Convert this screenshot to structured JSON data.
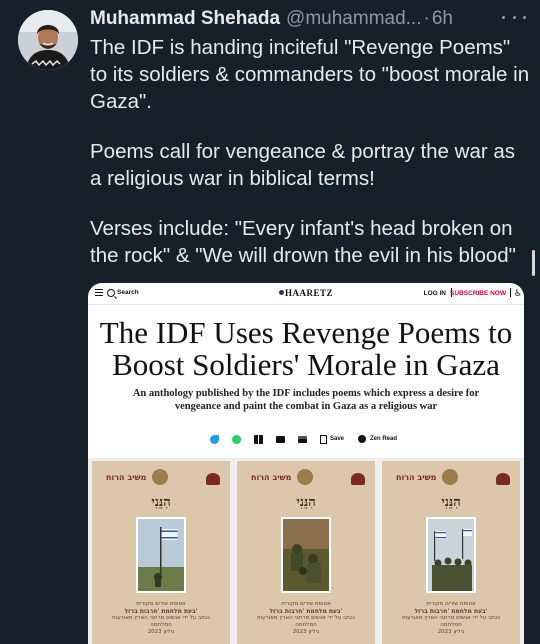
{
  "tweet": {
    "display_name": "Muhammad Shehada",
    "handle": "@muhammad...",
    "separator": "·",
    "time": "6h",
    "paragraphs": [
      "The IDF is handing inciteful \"Revenge Poems\" to its soldiers & commanders to \"boost morale in Gaza\".",
      "Poems call for vengeance & portray the war as a religious war in biblical terms!",
      "Verses include: \"Every infant's head broken on the rock\" & \"We will drown the evil in his blood\""
    ],
    "avatar_icon": "user-avatar",
    "more_icon": "more-horizontal-icon"
  },
  "article_card": {
    "nav": {
      "search_label": "Search",
      "logo": "HAARETZ",
      "login": "LOG IN",
      "subscribe": "SUBSCRIBE NOW",
      "subscribe_color": "#e4003a",
      "accessibility_icon": "♿"
    },
    "headline": "The IDF Uses Revenge Poems to Boost Soldiers' Morale in Gaza",
    "subheadline": "An anthology published by the IDF includes poems which express a desire for vengeance and paint the combat in Gaza as a religious war",
    "share": {
      "icons": [
        "twitter-icon",
        "whatsapp-icon",
        "gift-icon",
        "mail-icon",
        "print-icon"
      ],
      "save_label": "Save",
      "zen_label": "Zen Read"
    },
    "covers": [
      {
        "top_left": "משיב הרוח",
        "title": "הִנֵּנִי",
        "caption_1": "אסופת שירים מקורית",
        "caption_2": "בעת מלחמת 'חרבות ברזל'",
        "caption_3": "נכתב על ידי אנשים מרחבי הארץ מאורעות המלחמה",
        "caption_4": "2023 גיליון"
      },
      {
        "top_left": "משיב הרוח",
        "title": "הִנֵּנִי",
        "caption_1": "אסופת שירים מקורית",
        "caption_2": "בעת מלחמת 'חרבות ברזל'",
        "caption_3": "נכתב על ידי אנשים מרחבי הארץ מאורעות המלחמה",
        "caption_4": "2023 גיליון"
      },
      {
        "top_left": "משיב הרוח",
        "title": "הִנֵּנִי",
        "caption_1": "אסופת שירים מקורית",
        "caption_2": "בעת מלחמת 'חרבות ברזל'",
        "caption_3": "נכתב על ידי אנשים מרחבי הארץ מאורעות המלחמה",
        "caption_4": "2023 גיליון"
      }
    ]
  },
  "colors": {
    "background": "#15202b",
    "text_primary": "#e7e9ea",
    "text_secondary": "#8b98a5"
  }
}
